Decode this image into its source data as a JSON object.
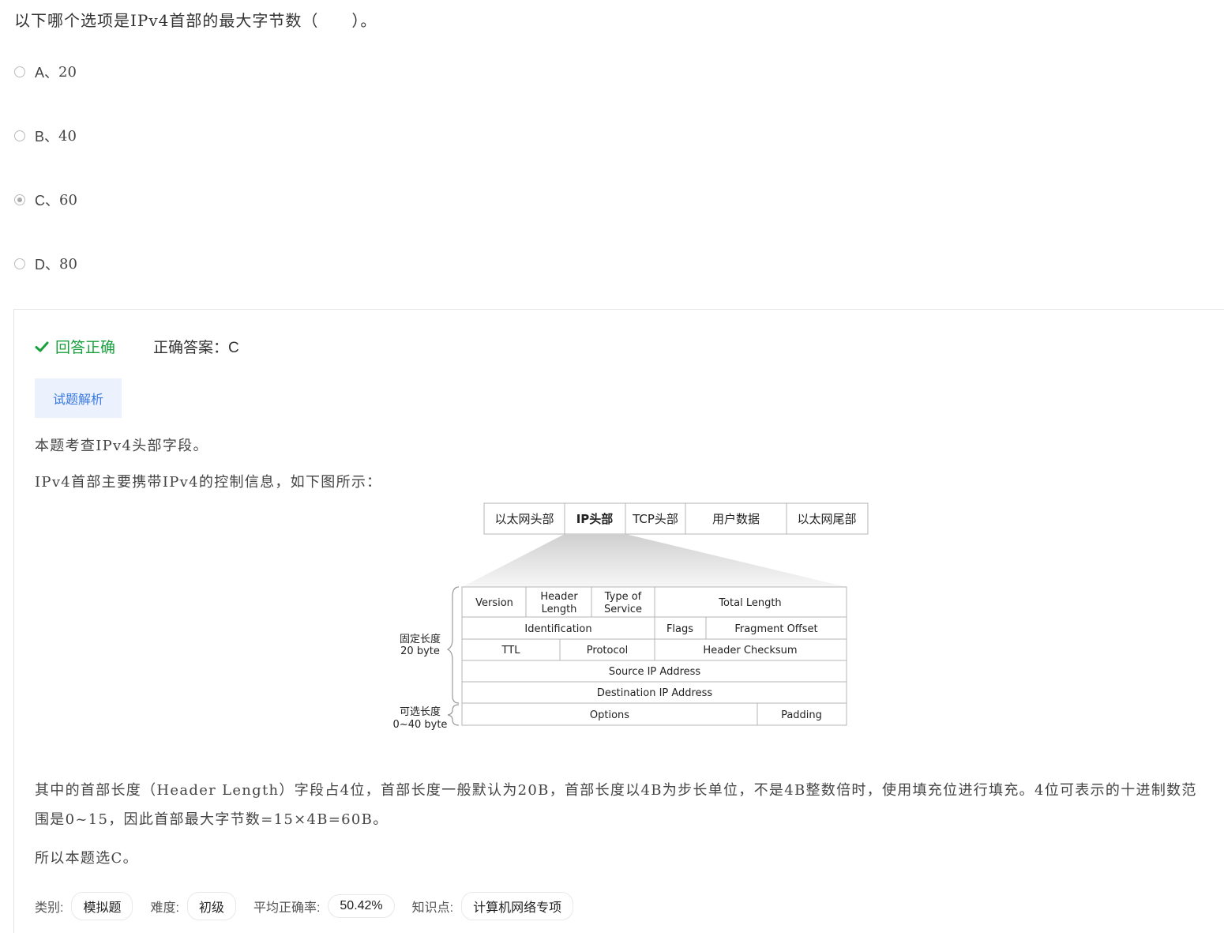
{
  "question": "以下哪个选项是IPv4首部的最大字节数（　　）。",
  "options": [
    {
      "letter": "A、",
      "text": "20",
      "checked": false
    },
    {
      "letter": "B、",
      "text": "40",
      "checked": false
    },
    {
      "letter": "C、",
      "text": "60",
      "checked": true
    },
    {
      "letter": "D、",
      "text": "80",
      "checked": false
    }
  ],
  "result": {
    "status": "回答正确",
    "answer": "正确答案：C",
    "status_color": "#18a03d"
  },
  "analysis_tab": "试题解析",
  "explanation": {
    "p1": "本题考查IPv4头部字段。",
    "p2": "IPv4首部主要携带IPv4的控制信息，如下图所示：",
    "p3": "其中的首部长度（Header Length）字段占4位，首部长度一般默认为20B，首部长度以4B为步长单位，不是4B整数倍时，使用填充位进行填充。4位可表示的十进制数范围是0~15，因此首部最大字节数=15×4B=60B。",
    "p4": "所以本题选C。"
  },
  "diagram": {
    "frame": [
      "以太网头部",
      "IP头部",
      "TCP头部",
      "用户数据",
      "以太网尾部"
    ],
    "fixed_label": [
      "固定长度",
      "20 byte"
    ],
    "optional_label": [
      "可选长度",
      "0~40 byte"
    ],
    "fields": {
      "version": "Version",
      "header_length": [
        "Header",
        "Length"
      ],
      "tos": [
        "Type of",
        "Service"
      ],
      "total_length": "Total Length",
      "identification": "Identification",
      "flags": "Flags",
      "fragment_offset": "Fragment Offset",
      "ttl": "TTL",
      "protocol": "Protocol",
      "checksum": "Header Checksum",
      "source": "Source IP Address",
      "destination": "Destination IP Address",
      "options": "Options",
      "padding": "Padding"
    }
  },
  "meta": {
    "category_label": "类别:",
    "category": "模拟题",
    "difficulty_label": "难度:",
    "difficulty": "初级",
    "accuracy_label": "平均正确率:",
    "accuracy": "50.42%",
    "knowledge_label": "知识点:",
    "knowledge": "计算机网络专项"
  }
}
